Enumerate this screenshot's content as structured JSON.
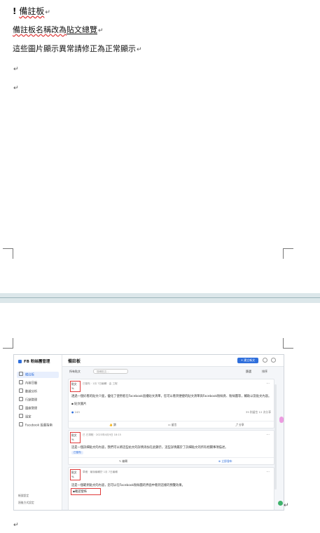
{
  "doc": {
    "heading": "備註板",
    "heading_mark": "!",
    "line1_prefix": "備註板名稱改為",
    "line1_underlined": "貼文總覽",
    "line2": "這些圖片顯示異常請修正為正常顯示",
    "return_mark": "↵"
  },
  "screenshot": {
    "app_name": "FB 粉絲團管理",
    "nav": [
      "備註板",
      "內容日曆",
      "數據分析",
      "行銷管理",
      "圖庫管理",
      "設定",
      "Facebook 設置指南"
    ],
    "footer_items": [
      "帳號設定",
      "過後方式設定"
    ],
    "page_title": "備註板",
    "new_button": "+ 建立新文",
    "filter_tab": "所有貼文",
    "search_placeholder": "搜尋貼文...",
    "filter_right": [
      "篩選",
      "排序"
    ],
    "posts": [
      {
        "avatar_label": "貼文",
        "meta": "已發布 · 1月 7日編輯 · 由 工程",
        "body": "透過一個好看的貼文介面，優化了使用者在Facebook直播貼文清單，您可以看到便捷的貼文清單與Facebook粉絲頁、粉絲團等，輔助以及貼文內容。",
        "image_alt": "貼文圖片",
        "stats_left": "243",
        "stats_right": "35 則留言   12 次分享",
        "actions": [
          "讚",
          "留言",
          "分享"
        ]
      },
      {
        "avatar_label": "貼文",
        "meta": "已 已排程 · 2023年4月9日 18:15",
        "body": "這是一個詳細貼文的內容，我們可以將這些帖文的詳情添加在此顯示，這些詳情屬於了詳細貼文的所有相關事項描述。",
        "tag": "已發布",
        "actions": [
          "編輯",
          "立即發布"
        ]
      },
      {
        "avatar_label": "貼文",
        "meta": "草稿 · 最後編輯於 1月 7日編輯",
        "body": "這是一個範例貼文的內容，您可以在Facebook粉絲團的界面中看到這樣的預覽效果。",
        "button_label": "確認發佈"
      }
    ]
  }
}
